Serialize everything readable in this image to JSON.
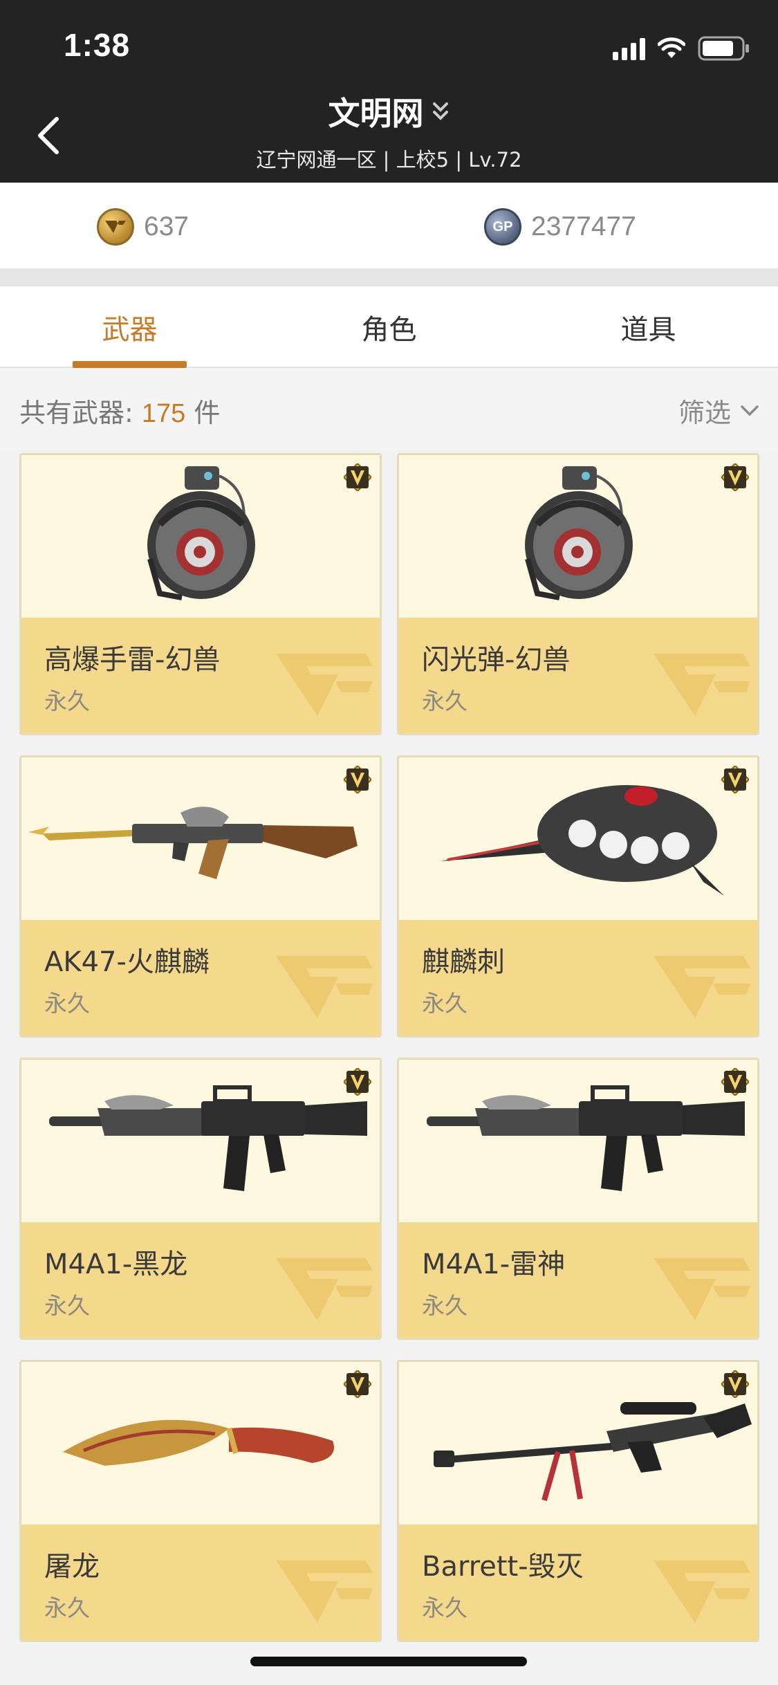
{
  "status_bar": {
    "time": "1:38"
  },
  "header": {
    "title": "文明网",
    "subtitle": "辽宁网通一区 | 上校5 | Lv.72"
  },
  "currency": {
    "coin_value": "637",
    "gp_label": "GP",
    "gp_value": "2377477"
  },
  "tabs": [
    {
      "label": "武器",
      "active": true
    },
    {
      "label": "角色",
      "active": false
    },
    {
      "label": "道具",
      "active": false
    }
  ],
  "summary": {
    "prefix": "共有武器:",
    "count": "175",
    "suffix": "件",
    "filter_label": "筛选"
  },
  "weapons": [
    {
      "name": "高爆手雷-幻兽",
      "duration": "永久",
      "icon": "grenade"
    },
    {
      "name": "闪光弹-幻兽",
      "duration": "永久",
      "icon": "grenade"
    },
    {
      "name": "AK47-火麒麟",
      "duration": "永久",
      "icon": "rifle-ak"
    },
    {
      "name": "麒麟刺",
      "duration": "永久",
      "icon": "knuckle-blade"
    },
    {
      "name": "M4A1-黑龙",
      "duration": "永久",
      "icon": "rifle-m4"
    },
    {
      "name": "M4A1-雷神",
      "duration": "永久",
      "icon": "rifle-m4"
    },
    {
      "name": "屠龙",
      "duration": "永久",
      "icon": "kukri-knife"
    },
    {
      "name": "Barrett-毁灭",
      "duration": "永久",
      "icon": "sniper-rifle"
    }
  ],
  "colors": {
    "header_bg": "#232323",
    "accent": "#c67b2a",
    "card_bg": "#fff8e1",
    "card_info_bg": "#f4d98c"
  }
}
